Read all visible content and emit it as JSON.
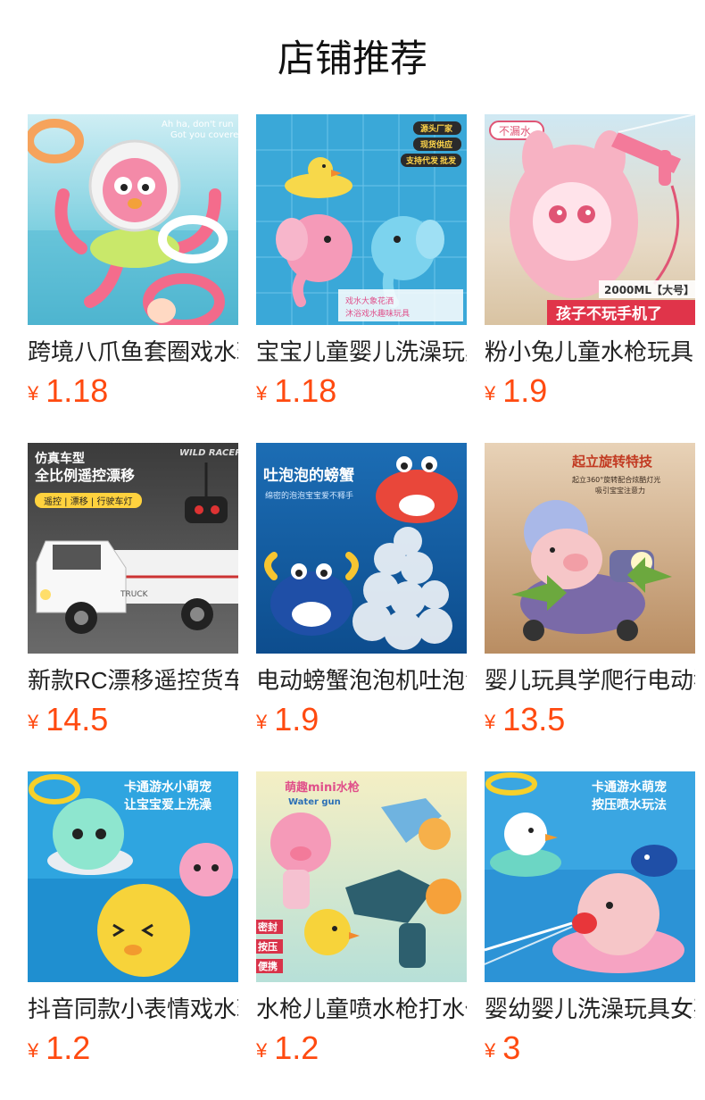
{
  "section_title": "店铺推荐",
  "products": [
    {
      "name": "跨境八爪鱼套圈戏水玩具",
      "currency": "¥",
      "price": "1.18",
      "image": "octopus-ring-toss-toy",
      "img_texts": [
        "Ah ha, don't run",
        "Got you covered"
      ]
    },
    {
      "name": "宝宝儿童婴儿洗澡玩具",
      "currency": "¥",
      "price": "1.18",
      "image": "elephant-duck-bath-toy",
      "img_texts": [
        "源头厂家",
        "现货供应",
        "支持代发",
        "批发",
        "戏水大象花洒",
        "沐浴戏水趣味玩具"
      ]
    },
    {
      "name": "粉小兔儿童水枪玩具",
      "currency": "¥",
      "price": "1.9",
      "image": "pink-rabbit-water-gun",
      "img_texts": [
        "不漏水",
        "2000ML【大号】",
        "孩子不玩手机了"
      ]
    },
    {
      "name": "新款RC漂移遥控货车",
      "currency": "¥",
      "price": "14.5",
      "image": "rc-drift-truck",
      "img_texts": [
        "仿真车型",
        "全比例遥控漂移",
        "遥控 | 漂移 | 行驶车灯",
        "WILD RACER",
        "TRUCK"
      ]
    },
    {
      "name": "电动螃蟹泡泡机吐泡泡",
      "currency": "¥",
      "price": "1.9",
      "image": "crab-bubble-machine",
      "img_texts": [
        "吐泡泡的螃蟹",
        "绵密的泡泡宝宝爱不释手"
      ]
    },
    {
      "name": "婴儿玩具学爬行电动猪",
      "currency": "¥",
      "price": "13.5",
      "image": "spinning-pig-scooter",
      "img_texts": [
        "起立旋转特技",
        "起立360°旋转配合炫酷灯光",
        "吸引宝宝注意力"
      ]
    },
    {
      "name": "抖音同款小表情戏水玩具",
      "currency": "¥",
      "price": "1.2",
      "image": "swimming-pets-toy",
      "img_texts": [
        "卡通游水小萌宠",
        "让宝宝爱上洗澡"
      ]
    },
    {
      "name": "水枪儿童喷水枪打水仗",
      "currency": "¥",
      "price": "1.2",
      "image": "mini-water-guns",
      "img_texts": [
        "萌趣mini水枪",
        "Water gun",
        "密封",
        "按压",
        "便携"
      ]
    },
    {
      "name": "婴幼婴儿洗澡玩具女孩",
      "currency": "¥",
      "price": "3",
      "image": "squirting-pig-bath-toy",
      "img_texts": [
        "卡通游水萌宠",
        "按压喷水玩法"
      ]
    }
  ]
}
